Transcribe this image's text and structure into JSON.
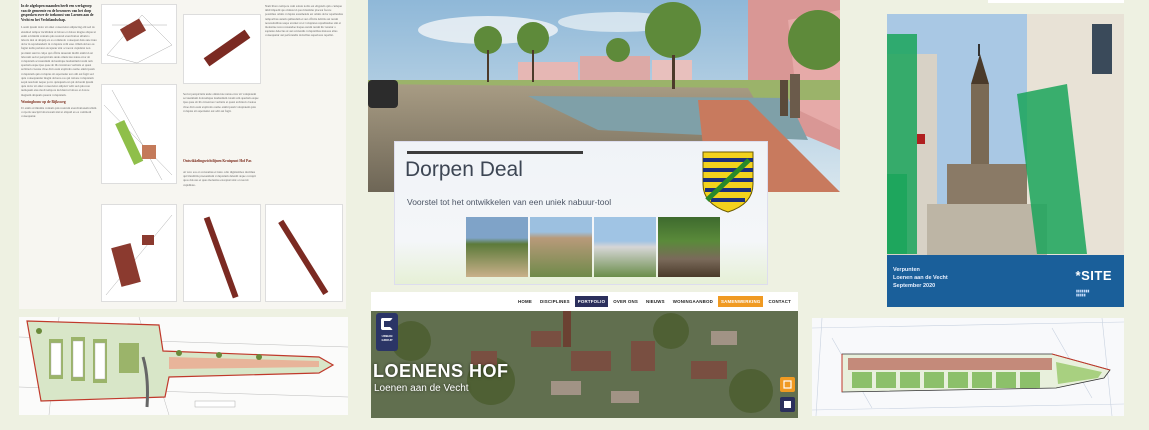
{
  "slide": {
    "title": "Dorpen Deal",
    "subtitle": "Voorstel tot het ontwikkelen van een uniek nabuur-tool"
  },
  "website": {
    "nav": [
      "HOME",
      "DISCIPLINES",
      "PORTFOLIO",
      "OVER ONS",
      "NIEUWS",
      "WONINGAANBOD",
      "SAMENWERKING",
      "CONTACT"
    ],
    "active_nav": "PORTFOLIO",
    "highlight_nav": "SAMENWERKING",
    "logo_text": "URBAN GROUP",
    "hero_title": "LOENENS HOF",
    "hero_subtitle": "Loenen aan de Vecht"
  },
  "cover": {
    "brand": "SITE",
    "footer_line1": "Verpunten",
    "footer_line2": "Loenen aan de Vecht",
    "footer_line3": "September 2020"
  },
  "article": {
    "heading1": "Woningbouw op de Rijksweg",
    "heading2": "Ontwikkelingsrichtlijnen Kruispunt Hof Pas"
  },
  "colors": {
    "background": "#eef1e2",
    "nav_active": "#2b2f5c",
    "nav_highlight": "#f09a22",
    "cover_green": "#1aa55a",
    "plan_red": "#c0392b"
  }
}
